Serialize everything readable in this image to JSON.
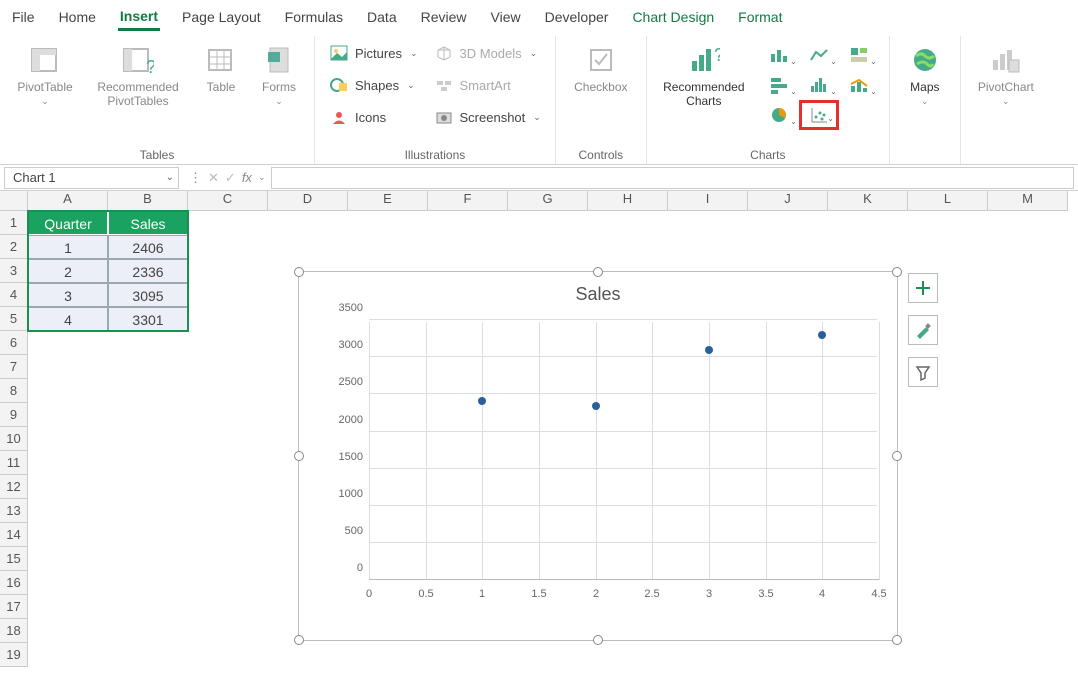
{
  "tabs": {
    "file": "File",
    "home": "Home",
    "insert": "Insert",
    "page_layout": "Page Layout",
    "formulas": "Formulas",
    "data": "Data",
    "review": "Review",
    "view": "View",
    "developer": "Developer",
    "chart_design": "Chart Design",
    "format": "Format"
  },
  "ribbon": {
    "tables": {
      "label": "Tables",
      "pivot": "PivotTable",
      "recommended": "Recommended PivotTables",
      "table": "Table",
      "forms": "Forms"
    },
    "illustrations": {
      "label": "Illustrations",
      "pictures": "Pictures",
      "shapes": "Shapes",
      "icons": "Icons",
      "models": "3D Models",
      "smartart": "SmartArt",
      "screenshot": "Screenshot"
    },
    "controls": {
      "label": "Controls",
      "checkbox": "Checkbox"
    },
    "charts": {
      "label": "Charts",
      "recommended": "Recommended Charts"
    },
    "tours": {
      "maps": "Maps"
    },
    "pivotchart": "PivotChart"
  },
  "namebox": "Chart 1",
  "sheet": {
    "cols": [
      "A",
      "B",
      "C",
      "D",
      "E",
      "F",
      "G",
      "H",
      "I",
      "J",
      "K",
      "L",
      "M"
    ],
    "rows": [
      "1",
      "2",
      "3",
      "4",
      "5",
      "6",
      "7",
      "8",
      "9",
      "10",
      "11",
      "12",
      "13",
      "14",
      "15",
      "16",
      "17",
      "18",
      "19"
    ],
    "headers": {
      "A": "Quarter",
      "B": "Sales"
    },
    "data": [
      {
        "quarter": "1",
        "sales": "2406"
      },
      {
        "quarter": "2",
        "sales": "2336"
      },
      {
        "quarter": "3",
        "sales": "3095"
      },
      {
        "quarter": "4",
        "sales": "3301"
      }
    ]
  },
  "chart_data": {
    "type": "scatter",
    "title": "Sales",
    "x": [
      1,
      2,
      3,
      4
    ],
    "y": [
      2406,
      2336,
      3095,
      3301
    ],
    "xlim": [
      0,
      4.5
    ],
    "ylim": [
      0,
      3500
    ],
    "xticks": [
      "0",
      "0.5",
      "1",
      "1.5",
      "2",
      "2.5",
      "3",
      "3.5",
      "4",
      "4.5"
    ],
    "yticks": [
      "0",
      "500",
      "1000",
      "1500",
      "2000",
      "2500",
      "3000",
      "3500"
    ]
  },
  "colors": {
    "accent": "#107c41",
    "highlight": "#e03030",
    "point": "#2a6099",
    "table_header": "#1aa260"
  }
}
